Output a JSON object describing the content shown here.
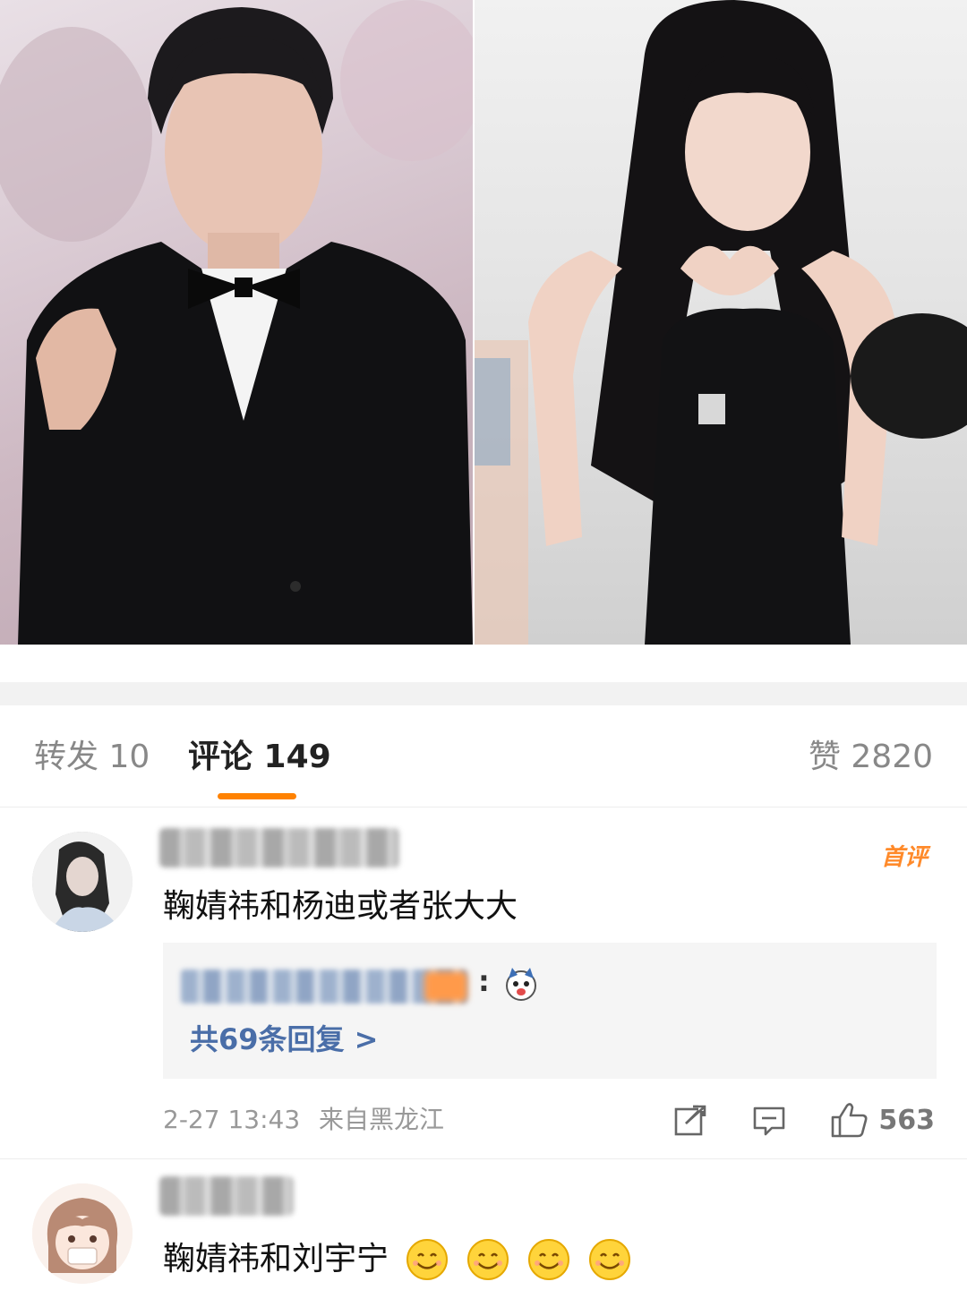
{
  "tabs": {
    "repost": "转发 10",
    "comments": "评论 149",
    "likes": "赞 2820"
  },
  "comments": [
    {
      "badge": "首评",
      "text": "鞠婧祎和杨迪或者张大大",
      "reply_preview_separator": ":",
      "reply_count": "共69条回复 >",
      "time": "2-27 13:43",
      "location": "来自黑龙江",
      "likes": "563"
    },
    {
      "text": "鞠婧祎和刘宇宁"
    }
  ],
  "colors": {
    "accent": "#ff8200",
    "link": "#4a6ea8",
    "badge": "#ff8a2a"
  }
}
